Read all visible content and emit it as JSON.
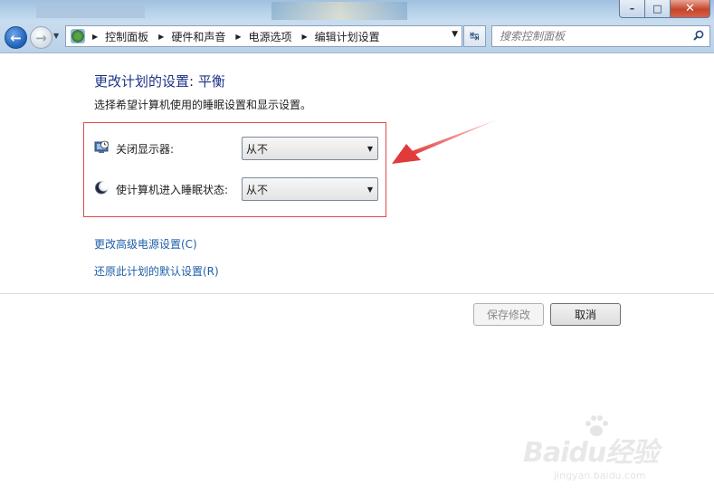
{
  "window": {
    "caption_buttons": {
      "minimize": "–",
      "maximize": "□",
      "close": "✕"
    }
  },
  "navigation": {
    "back_icon": "back-arrow-icon",
    "forward_icon": "forward-arrow-icon",
    "breadcrumb": [
      "控制面板",
      "硬件和声音",
      "电源选项",
      "编辑计划设置"
    ],
    "search_placeholder": "搜索控制面板"
  },
  "main": {
    "heading": "更改计划的设置: 平衡",
    "description": "选择希望计算机使用的睡眠设置和显示设置。",
    "settings": [
      {
        "label": "关闭显示器:",
        "icon": "monitor-clock-icon",
        "value": "从不"
      },
      {
        "label": "使计算机进入睡眠状态:",
        "icon": "moon-sleep-icon",
        "value": "从不"
      }
    ],
    "links": [
      {
        "text": "更改高级电源设置(C)"
      },
      {
        "text": "还原此计划的默认设置(R)"
      }
    ],
    "buttons": {
      "save": "保存修改",
      "cancel": "取消"
    }
  },
  "annotation": {
    "highlight_color": "#e04848"
  },
  "watermark": {
    "text": "Baidu经验",
    "subtext": "jingyan.baidu.com"
  }
}
